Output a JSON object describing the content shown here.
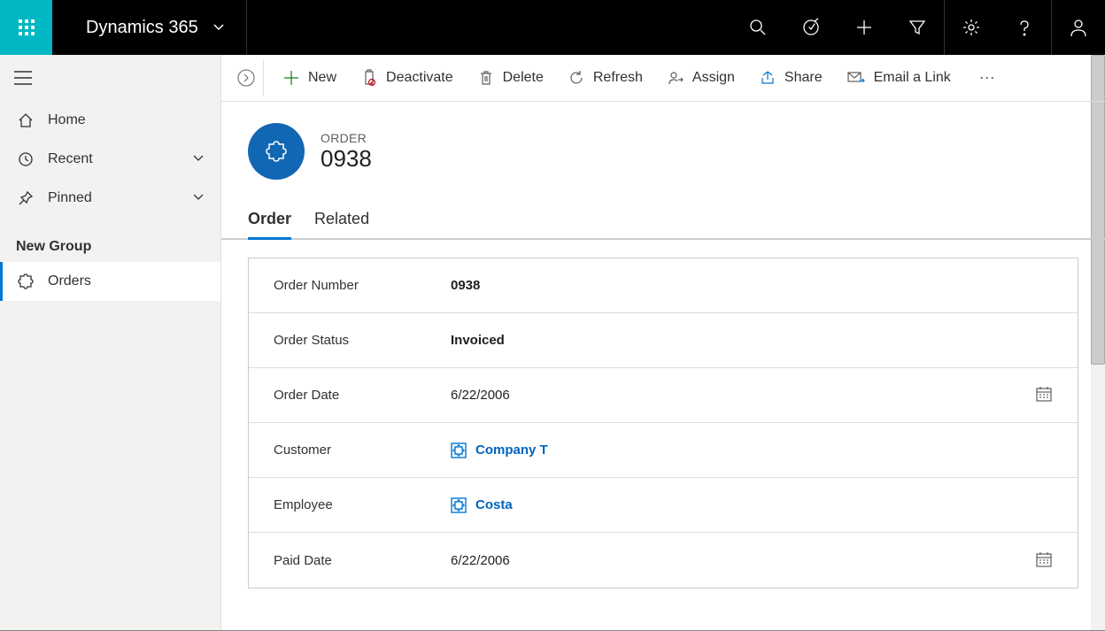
{
  "topbar": {
    "brand": "Dynamics 365"
  },
  "sidebar": {
    "home": "Home",
    "recent": "Recent",
    "pinned": "Pinned",
    "group_label": "New Group",
    "orders": "Orders"
  },
  "commands": {
    "new": "New",
    "deactivate": "Deactivate",
    "delete": "Delete",
    "refresh": "Refresh",
    "assign": "Assign",
    "share": "Share",
    "email": "Email a Link"
  },
  "record": {
    "type": "ORDER",
    "title": "0938"
  },
  "tabs": {
    "order": "Order",
    "related": "Related"
  },
  "fields": {
    "order_number_label": "Order Number",
    "order_number_value": "0938",
    "order_status_label": "Order Status",
    "order_status_value": "Invoiced",
    "order_date_label": "Order Date",
    "order_date_value": "6/22/2006",
    "customer_label": "Customer",
    "customer_value": "Company T",
    "employee_label": "Employee",
    "employee_value": "Costa",
    "paid_date_label": "Paid Date",
    "paid_date_value": "6/22/2006"
  }
}
